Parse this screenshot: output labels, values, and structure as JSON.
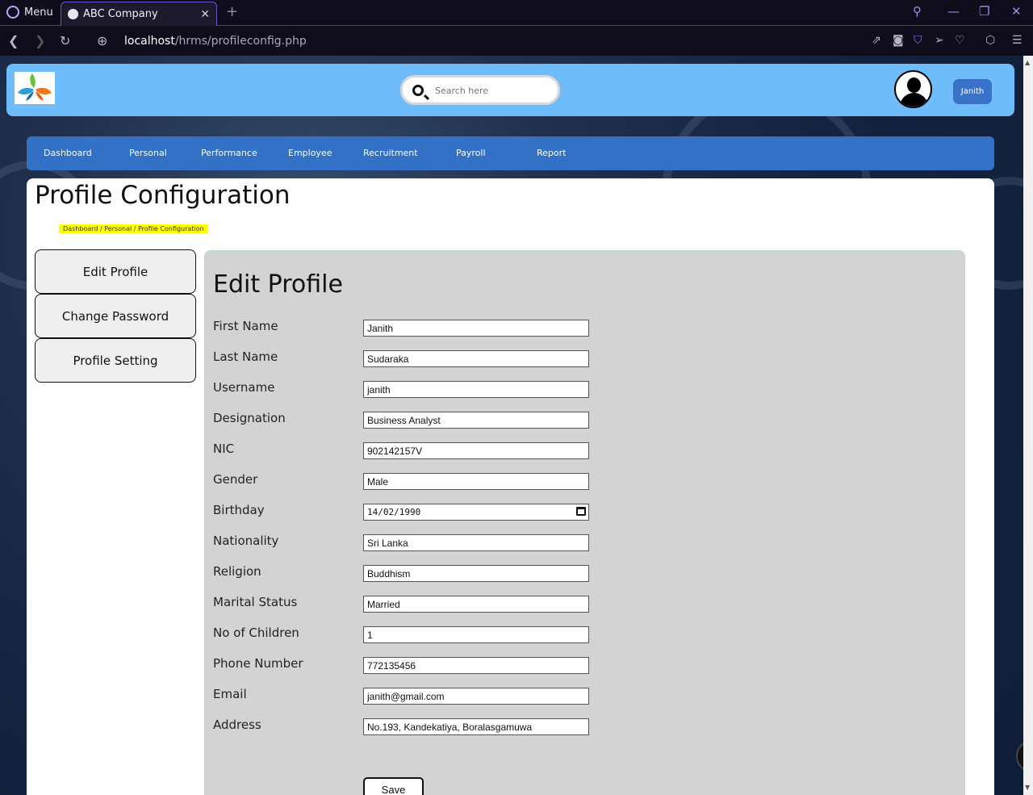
{
  "browser": {
    "menu_label": "Menu",
    "tab_title": "ABC Company",
    "tab_close": "✕",
    "new_tab": "+",
    "url_host": "localhost",
    "url_path": "/hrms/profileconfig.php"
  },
  "header": {
    "search_placeholder": "Search here",
    "user_label": "Janith"
  },
  "nav": {
    "items": [
      "Dashboard",
      "Personal",
      "Performance",
      "Employee",
      "Recruitment",
      "Payroll",
      "Report"
    ]
  },
  "page": {
    "title": "Profile Configuration",
    "breadcrumb": "Dashboard  /  Personal  /  Profile Configuration"
  },
  "sidebar": {
    "items": [
      "Edit Profile",
      "Change Password",
      "Profile Setting"
    ]
  },
  "form": {
    "title": "Edit Profile",
    "fields": [
      {
        "label": "First Name",
        "value": "Janith"
      },
      {
        "label": "Last Name",
        "value": "Sudaraka"
      },
      {
        "label": "Username",
        "value": "janith"
      },
      {
        "label": "Designation",
        "value": "Business Analyst"
      },
      {
        "label": "NIC",
        "value": "902142157V"
      },
      {
        "label": "Gender",
        "value": "Male"
      },
      {
        "label": "Birthday",
        "value": "14/02/1990"
      },
      {
        "label": "Nationality",
        "value": "Sri Lanka"
      },
      {
        "label": "Religion",
        "value": "Buddhism"
      },
      {
        "label": "Marital Status",
        "value": "Married"
      },
      {
        "label": "No of Children",
        "value": "1"
      },
      {
        "label": "Phone Number",
        "value": "772135456"
      },
      {
        "label": "Email",
        "value": "janith@gmail.com"
      },
      {
        "label": "Address",
        "value": "No.193, Kandekatiya, Boralasgamuwa"
      }
    ],
    "save_label": "Save"
  },
  "colors": {
    "header_bg": "#6fbcfb",
    "nav_bg": "#3271c6",
    "user_button": "#3a72c9",
    "panel_bg": "#d3d3d3",
    "breadcrumb_bg": "#ffff00"
  }
}
